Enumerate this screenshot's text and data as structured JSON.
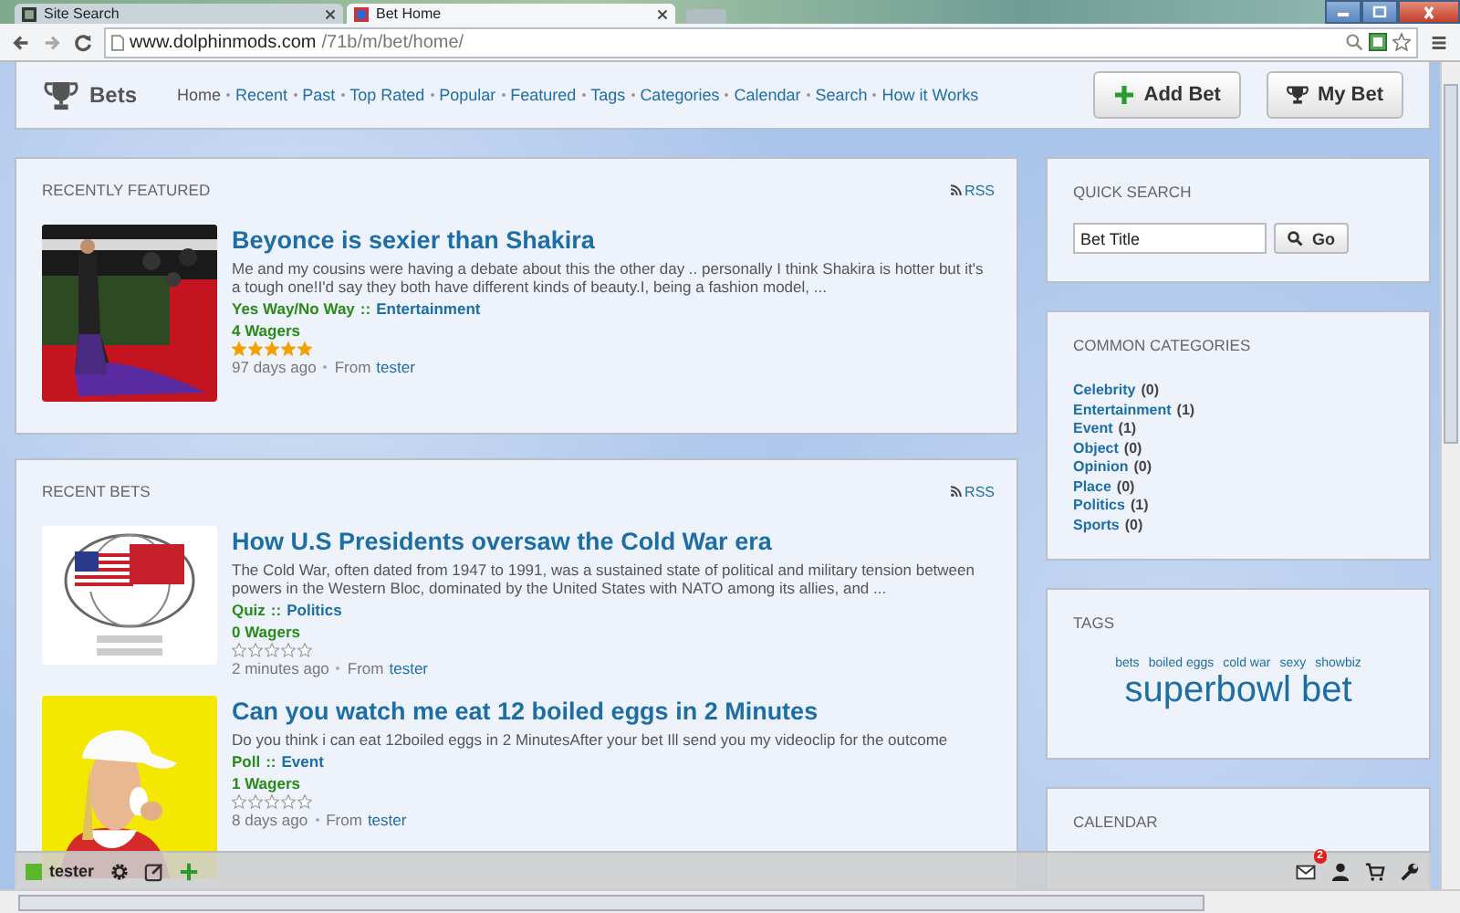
{
  "browser": {
    "tabs": [
      {
        "title": "Site Search",
        "selected": false
      },
      {
        "title": "Bet Home",
        "selected": true
      }
    ],
    "url_host": "www.dolphinmods.com",
    "url_path": "/71b/m/bet/home/"
  },
  "header": {
    "brand": "Bets",
    "nav": [
      "Home",
      "Recent",
      "Past",
      "Top Rated",
      "Popular",
      "Featured",
      "Tags",
      "Categories",
      "Calendar",
      "Search",
      "How it Works"
    ],
    "buttons": [
      {
        "label": "Add Bet",
        "kind": "add"
      },
      {
        "label": "My Bet",
        "kind": "trophy"
      }
    ]
  },
  "sections": [
    {
      "title": "RECENTLY FEATURED",
      "rss": "RSS",
      "items": [
        {
          "title": "Beyonce is sexier than Shakira",
          "excerpt": "Me and my cousins were having a debate about this the other day .. personally I think Shakira is hotter but it's a tough one!I'd say they both have different kinds of beauty.I, being a fashion model, ...",
          "type": "Yes Way/No Way",
          "separator": "::",
          "category": "Entertainment",
          "wagers": "4 Wagers",
          "stars": 5,
          "age": "97 days ago",
          "from": "From",
          "author": "tester"
        }
      ]
    },
    {
      "title": "RECENT BETS",
      "rss": "RSS",
      "items": [
        {
          "title": "How U.S Presidents oversaw the Cold War era",
          "excerpt": "The Cold War, often dated from 1947 to 1991, was a sustained state of political and military tension between powers in the Western Bloc, dominated by the United States with NATO among its allies, and ...",
          "type": "Quiz",
          "separator": "::",
          "category": "Politics",
          "wagers": "0 Wagers",
          "stars": 0,
          "age": "2 minutes ago",
          "from": "From",
          "author": "tester"
        },
        {
          "title": "Can you watch me eat 12 boiled eggs in 2 Minutes",
          "excerpt": "Do you think i can eat 12boiled eggs in 2 MinutesAfter your bet Ill send you my videoclip for the outcome",
          "type": "Poll",
          "separator": "::",
          "category": "Event",
          "wagers": "1 Wagers",
          "stars": 0,
          "age": "8 days ago",
          "from": "From",
          "author": "tester"
        }
      ]
    }
  ],
  "sidebar": {
    "quick_search": {
      "title": "QUICK SEARCH",
      "value": "Bet Title",
      "button": "Go"
    },
    "categories": {
      "title": "COMMON CATEGORIES",
      "items": [
        {
          "name": "Celebrity",
          "count": "(0)"
        },
        {
          "name": "Entertainment",
          "count": "(1)"
        },
        {
          "name": "Event",
          "count": "(1)"
        },
        {
          "name": "Object",
          "count": "(0)"
        },
        {
          "name": "Opinion",
          "count": "(0)"
        },
        {
          "name": "Place",
          "count": "(0)"
        },
        {
          "name": "Politics",
          "count": "(1)"
        },
        {
          "name": "Sports",
          "count": "(0)"
        }
      ]
    },
    "tags": {
      "title": "TAGS",
      "items": [
        {
          "label": "bets",
          "kind": "small"
        },
        {
          "label": "boiled eggs",
          "kind": "small"
        },
        {
          "label": "cold war",
          "kind": "small"
        },
        {
          "label": "sexy",
          "kind": "small"
        },
        {
          "label": "showbiz",
          "kind": "small"
        },
        {
          "label": "superbowl bet",
          "kind": "large"
        }
      ]
    },
    "calendar": {
      "title": "CALENDAR"
    }
  },
  "toolbar": {
    "user": "tester",
    "mail_badge": "2"
  }
}
